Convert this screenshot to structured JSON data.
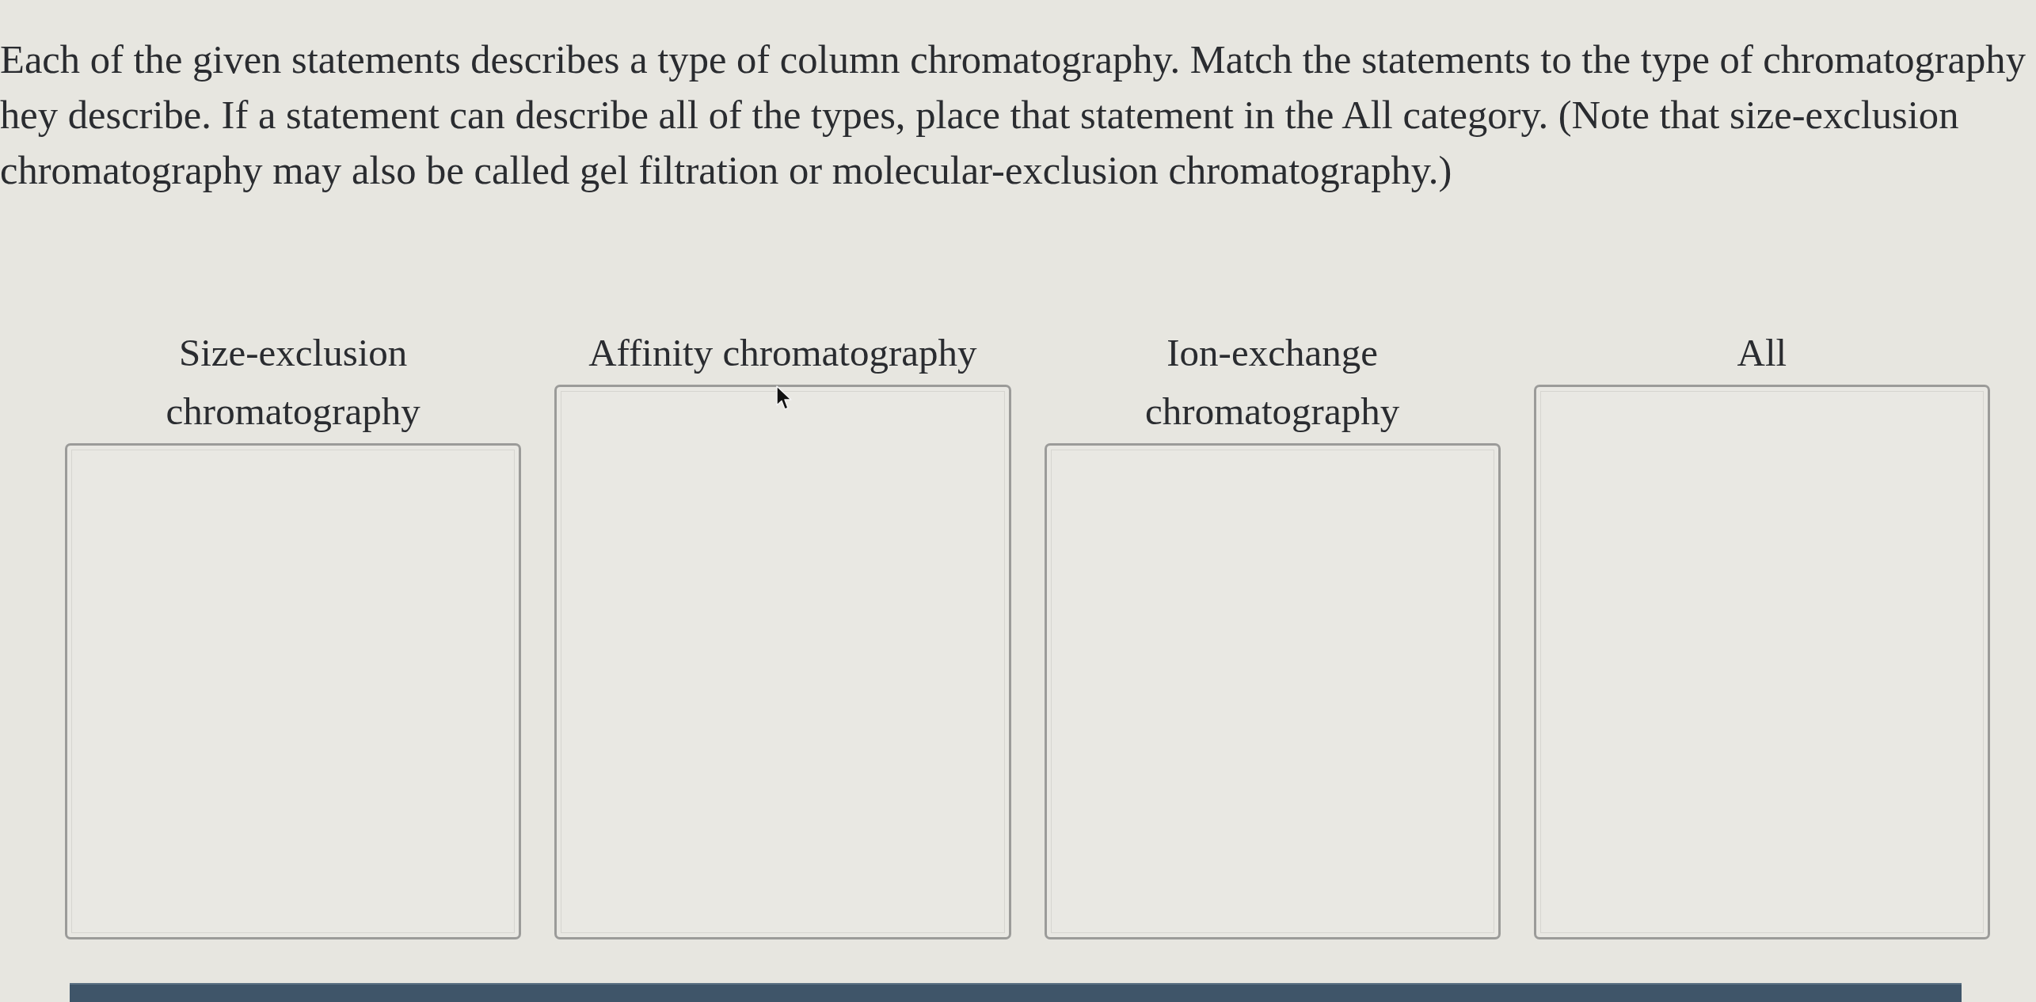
{
  "instructions": "Each of the given statements describes a type of column chromatography. Match the statements to the type of chromatography hey describe. If a statement can describe all of the types, place that statement in the All category. (Note that size-exclusion chromatography may also be called gel filtration or molecular-exclusion chromatography.)",
  "categories": [
    {
      "label": "Size-exclusion chromatography"
    },
    {
      "label": "Affinity chromatography"
    },
    {
      "label": "Ion-exchange chromatography"
    },
    {
      "label": "All"
    }
  ]
}
